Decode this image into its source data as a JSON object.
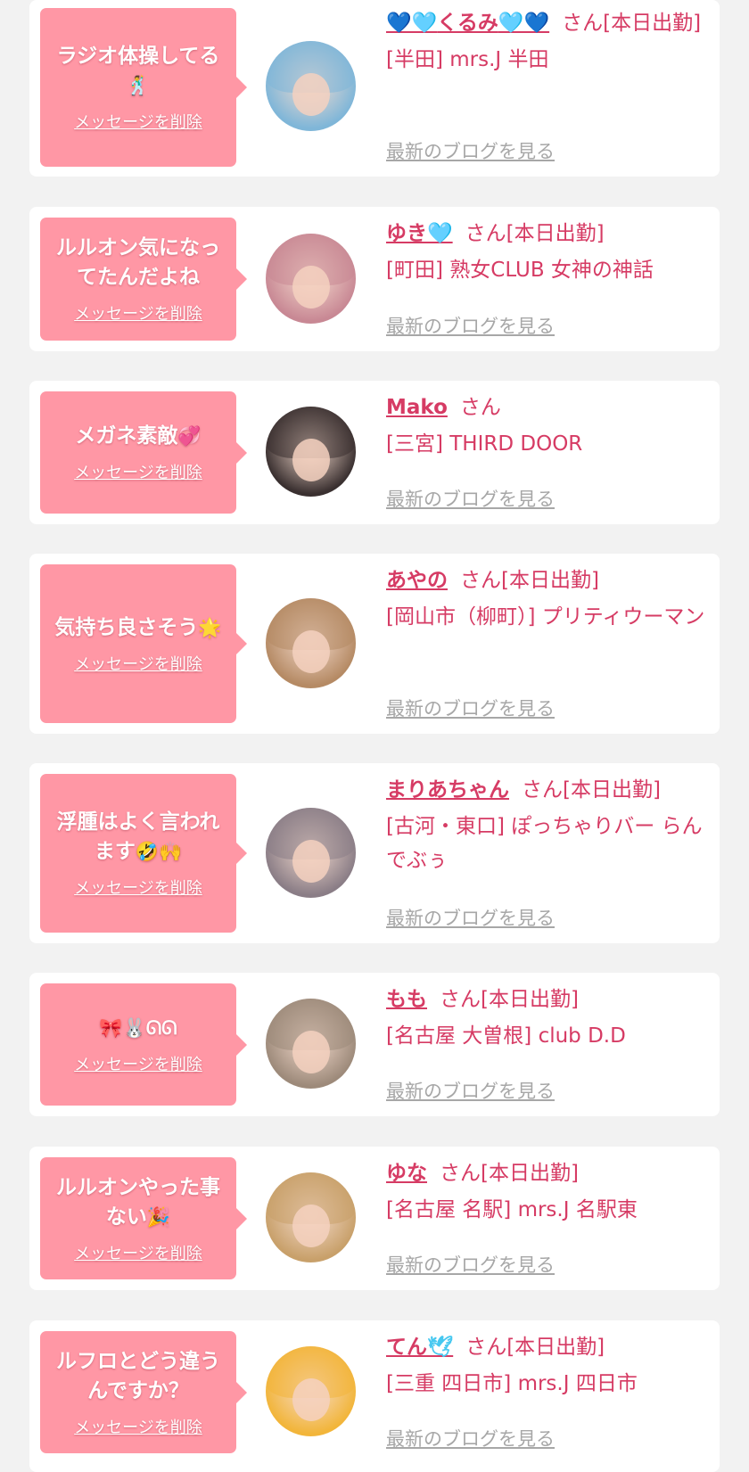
{
  "delete_label": "メッセージを削除",
  "blog_label": "最新のブログを見る",
  "colors": {
    "page_bg": "#f2f2f2",
    "card_bg": "#ffffff",
    "bubble_bg": "#ff97a5",
    "name_color": "#d63b64",
    "shop_color": "#d63b64",
    "blog_link_color": "#a7a7a7"
  },
  "cards": [
    {
      "message": "ラジオ体操してる",
      "message_emoji": "🕺",
      "name": "くるみ",
      "name_prefix_emoji": "💙🩵",
      "name_suffix_emoji": "🩵💙",
      "suffix": "さん[本日出勤]",
      "shop": "[半田] mrs.J 半田",
      "avatar_icon": "avatar-photo-icon"
    },
    {
      "message": "ルルオン気になってたんだよね",
      "message_emoji": "",
      "name": "ゆき",
      "name_prefix_emoji": "",
      "name_suffix_emoji": "🩵",
      "suffix": "さん[本日出勤]",
      "shop": "[町田] 熟女CLUB 女神の神話",
      "avatar_icon": "avatar-photo-icon"
    },
    {
      "message": "メガネ素敵",
      "message_emoji": "💞",
      "name": "Mako",
      "name_prefix_emoji": "",
      "name_suffix_emoji": "",
      "suffix": "さん",
      "shop": "[三宮] THIRD DOOR",
      "avatar_icon": "avatar-photo-icon"
    },
    {
      "message": "気持ち良さそう",
      "message_emoji": "🌟",
      "name": "あやの",
      "name_prefix_emoji": "",
      "name_suffix_emoji": "",
      "suffix": "さん[本日出勤]",
      "shop": "[岡山市（柳町）] プリティウーマン",
      "avatar_icon": "avatar-photo-icon"
    },
    {
      "message": "浮腫はよく言われます",
      "message_emoji": "🤣🙌",
      "name": "まりあちゃん",
      "name_prefix_emoji": "",
      "name_suffix_emoji": "",
      "suffix": "さん[本日出勤]",
      "shop": "[古河・東口] ぽっちゃりバー らんでぶぅ",
      "avatar_icon": "avatar-photo-icon"
    },
    {
      "message": "",
      "message_emoji": "🎀🐰ᘏᘏ",
      "name": "もも",
      "name_prefix_emoji": "",
      "name_suffix_emoji": "",
      "suffix": "さん[本日出勤]",
      "shop": "[名古屋 大曽根] club D.D",
      "avatar_icon": "avatar-photo-icon"
    },
    {
      "message": "ルルオンやった事ない",
      "message_emoji": "🎉",
      "name": "ゆな",
      "name_prefix_emoji": "",
      "name_suffix_emoji": "",
      "suffix": "さん[本日出勤]",
      "shop": "[名古屋 名駅] mrs.J 名駅東",
      "avatar_icon": "avatar-photo-icon"
    },
    {
      "message": "ルフロとどう違うんですか？",
      "message_emoji": "",
      "name": "てん",
      "name_prefix_emoji": "",
      "name_suffix_emoji": "🕊",
      "suffix": "さん[本日出勤]",
      "shop": "[三重 四日市] mrs.J 四日市",
      "avatar_icon": "avatar-photo-icon"
    }
  ]
}
